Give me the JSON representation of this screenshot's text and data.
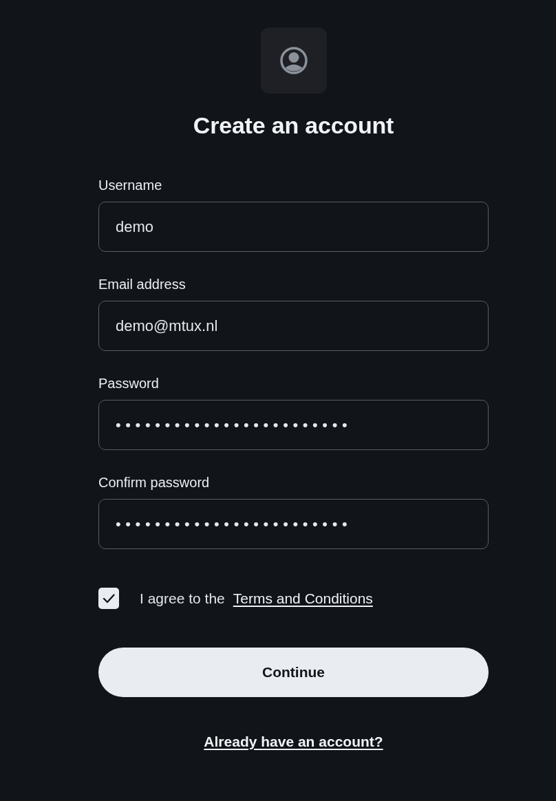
{
  "title": "Create an account",
  "fields": [
    {
      "kind": "text",
      "label": "Username",
      "value": "demo"
    },
    {
      "kind": "text",
      "label": "Email address",
      "value": "demo@mtux.nl"
    },
    {
      "kind": "password",
      "label": "Password",
      "value": "••••••••••••••••••••••••"
    },
    {
      "kind": "password",
      "label": "Confirm password",
      "value": "••••••••••••••••••••••••"
    }
  ],
  "agreement": {
    "checked": true,
    "text": "I agree to the",
    "link": "Terms and Conditions"
  },
  "submit_button": "Continue",
  "signin_link": "Already have an account?"
}
